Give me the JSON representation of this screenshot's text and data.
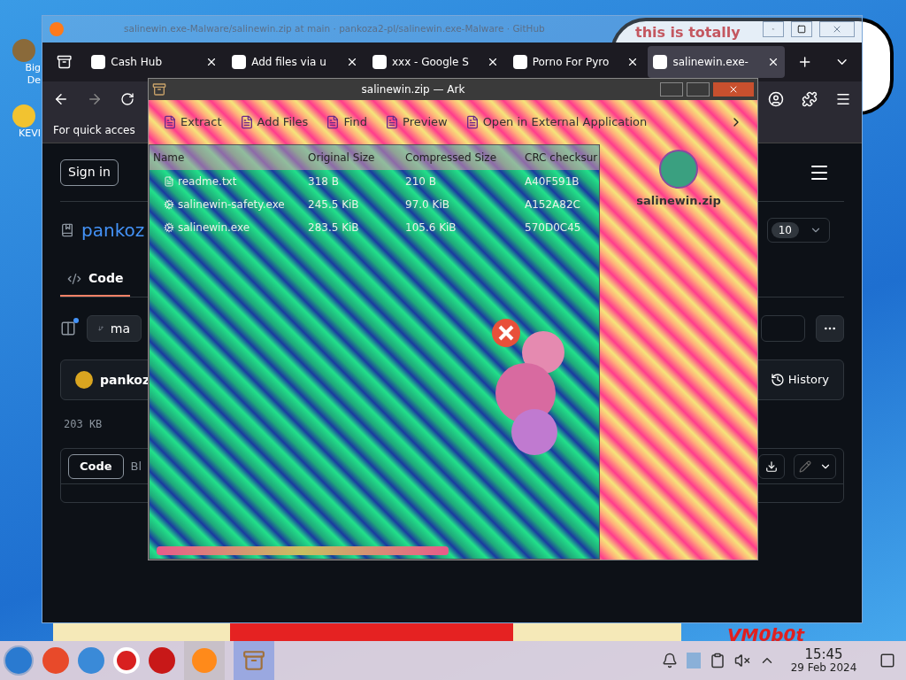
{
  "desktop": {
    "icons": [
      {
        "lines": [
          "Big",
          "De"
        ]
      },
      {
        "lines": [
          "KEVI"
        ]
      }
    ],
    "wallpaper_texts": [
      "this is totally",
      "VM0b0t"
    ]
  },
  "browser": {
    "title": "salinewin.exe-Malware/salinewin.zip at main · pankoza2-pl/salinewin.exe-Malware · GitHub",
    "tabs": [
      {
        "label": "Cash Hub",
        "selected": false
      },
      {
        "label": "Add files via u",
        "selected": false
      },
      {
        "label": "xxx - Google S",
        "selected": false
      },
      {
        "label": "Porno For Pyro",
        "selected": false
      },
      {
        "label": "salinewin.exe-",
        "selected": true
      }
    ],
    "bookmarks_hint": "For quick acces",
    "page": {
      "sign_in": "Sign in",
      "repo": "pankoz",
      "watch_count": "10",
      "repo_tabs": [
        {
          "label": "Code",
          "selected": true
        }
      ],
      "branch": "ma",
      "author": "pankoz",
      "history": "History",
      "size": "203 KB",
      "view_tabs": [
        {
          "label": "Code",
          "selected": true
        },
        {
          "label": "Bl",
          "selected": false
        }
      ]
    }
  },
  "ark": {
    "title": "salinewin.zip — Ark",
    "toolbar": [
      "Extract",
      "Add Files",
      "Find",
      "Preview",
      "Open in External Application"
    ],
    "columns": [
      "Name",
      "Original Size",
      "Compressed Size",
      "CRC checksur"
    ],
    "rows": [
      {
        "name": "readme.txt",
        "original": "318 B",
        "compressed": "210 B",
        "crc": "A40F591B"
      },
      {
        "name": "salinewin-safety.exe",
        "original": "245.5 KiB",
        "compressed": "97.0 KiB",
        "crc": "A152A82C"
      },
      {
        "name": "salinewin.exe",
        "original": "283.5 KiB",
        "compressed": "105.6 KiB",
        "crc": "570D0C45"
      }
    ],
    "archive_name": "salinewin.zip"
  },
  "taskbar": {
    "time": "15:45",
    "date": "29 Feb 2024"
  }
}
